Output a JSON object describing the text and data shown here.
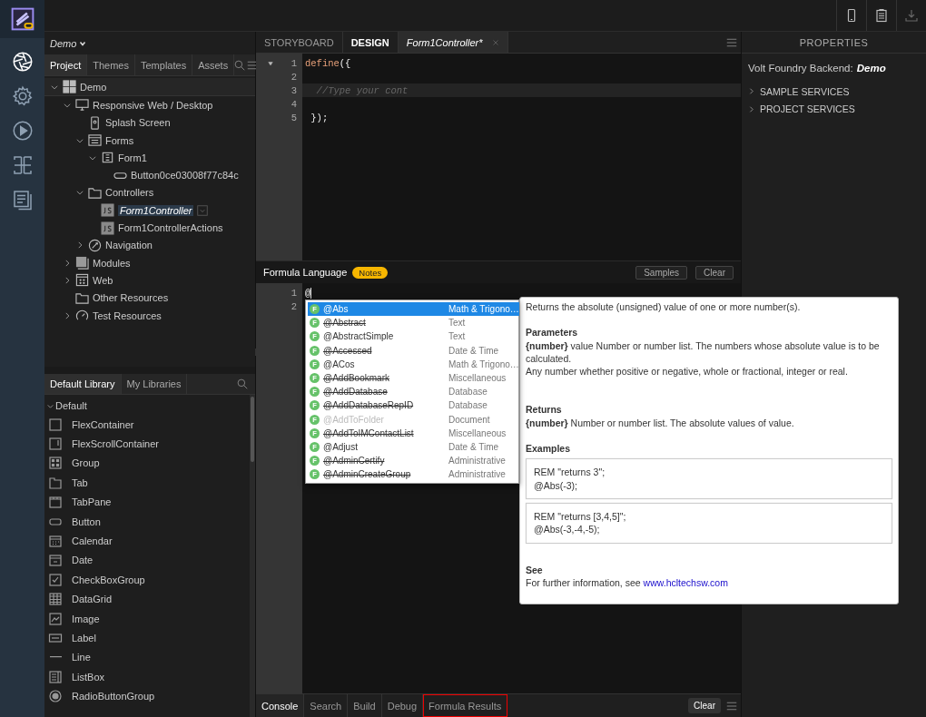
{
  "rail": [
    {
      "kind": "aperture",
      "selected": true
    },
    {
      "kind": "gear",
      "selected": false
    },
    {
      "kind": "play",
      "selected": false
    },
    {
      "kind": "layout",
      "selected": false
    },
    {
      "kind": "document",
      "selected": false
    }
  ],
  "toolbar": [
    {
      "kind": "phone",
      "disabled": false
    },
    {
      "kind": "clipboard",
      "disabled": false
    },
    {
      "kind": "download",
      "disabled": true
    }
  ],
  "project_name": "Demo",
  "project_tabs": [
    {
      "label": "Project",
      "selected": true
    },
    {
      "label": "Themes",
      "selected": false
    },
    {
      "label": "Templates",
      "selected": false
    },
    {
      "label": "Assets",
      "selected": false
    }
  ],
  "tree": [
    {
      "label": "Demo",
      "kind": "grid",
      "expanded": true,
      "selected": false,
      "children": [
        {
          "label": "Responsive Web / Desktop",
          "kind": "monitor",
          "expanded": true,
          "selected": false,
          "children": [
            {
              "label": "Splash Screen",
              "kind": "splash",
              "selected": false
            },
            {
              "label": "Forms",
              "kind": "forms",
              "expanded": true,
              "selected": false,
              "children": [
                {
                  "label": "Form1",
                  "kind": "form",
                  "expanded": true,
                  "selected": false,
                  "children": [
                    {
                      "label": "Button0ce03008f77c84c",
                      "kind": "button",
                      "selected": false
                    }
                  ]
                }
              ]
            },
            {
              "label": "Controllers",
              "kind": "folder",
              "expanded": true,
              "selected": false,
              "children": [
                {
                  "label": "Form1Controller",
                  "kind": "js",
                  "selected": true
                },
                {
                  "label": "Form1ControllerActions",
                  "kind": "js",
                  "selected": false
                }
              ]
            },
            {
              "label": "Navigation",
              "kind": "navigation",
              "expanded": false,
              "selected": false
            }
          ]
        },
        {
          "label": "Modules",
          "kind": "module",
          "expanded": false,
          "selected": false
        },
        {
          "label": "Web",
          "kind": "web",
          "expanded": false,
          "selected": false
        },
        {
          "label": "Other Resources",
          "kind": "folder",
          "selected": false
        },
        {
          "label": "Test Resources",
          "kind": "test",
          "expanded": false,
          "selected": false
        }
      ]
    }
  ],
  "library_tabs": [
    {
      "label": "Default Library",
      "selected": true
    },
    {
      "label": "My Libraries",
      "selected": false
    }
  ],
  "library_group": {
    "label": "Default",
    "expanded": true
  },
  "library_items": [
    {
      "label": "FlexContainer",
      "kind": "flex"
    },
    {
      "label": "FlexScrollContainer",
      "kind": "scroll"
    },
    {
      "label": "Group",
      "kind": "group"
    },
    {
      "label": "Tab",
      "kind": "tab"
    },
    {
      "label": "TabPane",
      "kind": "tabpane"
    },
    {
      "label": "Button",
      "kind": "button"
    },
    {
      "label": "Calendar",
      "kind": "calendar"
    },
    {
      "label": "Date",
      "kind": "date"
    },
    {
      "label": "CheckBoxGroup",
      "kind": "checkbox"
    },
    {
      "label": "DataGrid",
      "kind": "datagrid"
    },
    {
      "label": "Image",
      "kind": "image"
    },
    {
      "label": "Label",
      "kind": "label"
    },
    {
      "label": "Line",
      "kind": "line"
    },
    {
      "label": "ListBox",
      "kind": "listbox"
    },
    {
      "label": "RadioButtonGroup",
      "kind": "radio"
    }
  ],
  "editor_tabs": [
    {
      "label": "STORYBOARD",
      "kind": "view",
      "selected": false,
      "active": false
    },
    {
      "label": "DESIGN",
      "kind": "view",
      "selected": false,
      "active": true
    },
    {
      "label": "Form1Controller*",
      "kind": "file",
      "selected": true,
      "active": true
    }
  ],
  "code_lines": [
    {
      "number": "1",
      "fold": true,
      "current": false,
      "tokens": [
        {
          "text": "define",
          "kind": "keyword"
        },
        {
          "text": "({",
          "kind": "plain"
        }
      ]
    },
    {
      "number": "2",
      "fold": false,
      "current": false
    },
    {
      "number": "3",
      "fold": false,
      "current": true,
      "tokens": [
        {
          "text": "  //Type your cont",
          "kind": "comment"
        }
      ]
    },
    {
      "number": "4",
      "fold": false,
      "current": false
    },
    {
      "number": "5",
      "fold": false,
      "current": false,
      "tokens": [
        {
          "text": " });",
          "kind": "plain"
        }
      ]
    }
  ],
  "formula": {
    "title": "Formula Language",
    "badge": "Notes",
    "buttons": [
      "Samples",
      "Clear"
    ],
    "lines": [
      {
        "number": "1",
        "text": "@",
        "cursor": true
      },
      {
        "number": "2"
      }
    ]
  },
  "completions": [
    {
      "badge": "F",
      "name": "@Abs",
      "category": "Math & Trigono…",
      "selected": true,
      "deprecated": false,
      "disabled": false
    },
    {
      "badge": "F",
      "name": "@Abstract",
      "category": "Text",
      "selected": false,
      "deprecated": true,
      "disabled": false
    },
    {
      "badge": "F",
      "name": "@AbstractSimple",
      "category": "Text",
      "selected": false,
      "deprecated": false,
      "disabled": false
    },
    {
      "badge": "F",
      "name": "@Accessed",
      "category": "Date & Time",
      "selected": false,
      "deprecated": true,
      "disabled": false
    },
    {
      "badge": "F",
      "name": "@ACos",
      "category": "Math & Trigono…",
      "selected": false,
      "deprecated": false,
      "disabled": false
    },
    {
      "badge": "F",
      "name": "@AddBookmark",
      "category": "Miscellaneous",
      "selected": false,
      "deprecated": true,
      "disabled": false
    },
    {
      "badge": "F",
      "name": "@AddDatabase",
      "category": "Database",
      "selected": false,
      "deprecated": true,
      "disabled": false
    },
    {
      "badge": "F",
      "name": "@AddDatabaseRepID",
      "category": "Database",
      "selected": false,
      "deprecated": true,
      "disabled": false
    },
    {
      "badge": "F",
      "name": "@AddToFolder",
      "category": "Document",
      "selected": false,
      "deprecated": false,
      "disabled": true
    },
    {
      "badge": "F",
      "name": "@AddToIMContactList",
      "category": "Miscellaneous",
      "selected": false,
      "deprecated": true,
      "disabled": false
    },
    {
      "badge": "F",
      "name": "@Adjust",
      "category": "Date & Time",
      "selected": false,
      "deprecated": false,
      "disabled": false
    },
    {
      "badge": "F",
      "name": "@AdminCertify",
      "category": "Administrative",
      "selected": false,
      "deprecated": true,
      "disabled": false
    },
    {
      "badge": "F",
      "name": "@AdminCreateGroup",
      "category": "Administrative",
      "selected": false,
      "deprecated": true,
      "disabled": false
    }
  ],
  "doc": {
    "description": "Returns the absolute (unsigned) value of one or more number(s).",
    "sections": [
      {
        "kind": "text",
        "heading": "Parameters",
        "paragraphs": [
          "**{number}** value Number or number list. The numbers whose absolute value is to be calculated.",
          "Any number whether positive or negative, whole or fractional, integer or real."
        ]
      },
      {
        "kind": "text",
        "heading": "Returns",
        "paragraphs": [
          "**{number}** Number or number list. The absolute values of value."
        ]
      },
      {
        "kind": "examples",
        "heading": "Examples",
        "examples": [
          {
            "lines": [
              "REM \"returns 3\";",
              "@Abs(-3);"
            ]
          },
          {
            "lines": [
              "REM \"returns [3,4,5]\";",
              "@Abs(-3,-4,-5);"
            ]
          }
        ]
      },
      {
        "kind": "link",
        "heading": "See",
        "text": "For further information, see",
        "link": "www.hcltechsw.com"
      }
    ]
  },
  "console_tabs": [
    {
      "label": "Console",
      "selected": true,
      "outlined": false
    },
    {
      "label": "Search",
      "selected": false,
      "outlined": false
    },
    {
      "label": "Build",
      "selected": false,
      "outlined": false
    },
    {
      "label": "Debug",
      "selected": false,
      "outlined": false
    },
    {
      "label": "Formula Results",
      "selected": false,
      "outlined": true
    }
  ],
  "console_clear": "Clear",
  "properties": {
    "title": "PROPERTIES",
    "backend_label": "Volt Foundry Backend:",
    "backend_value": "Demo",
    "sections": [
      {
        "label": "SAMPLE SERVICES",
        "expanded": false
      },
      {
        "label": "PROJECT SERVICES",
        "expanded": false
      }
    ]
  }
}
